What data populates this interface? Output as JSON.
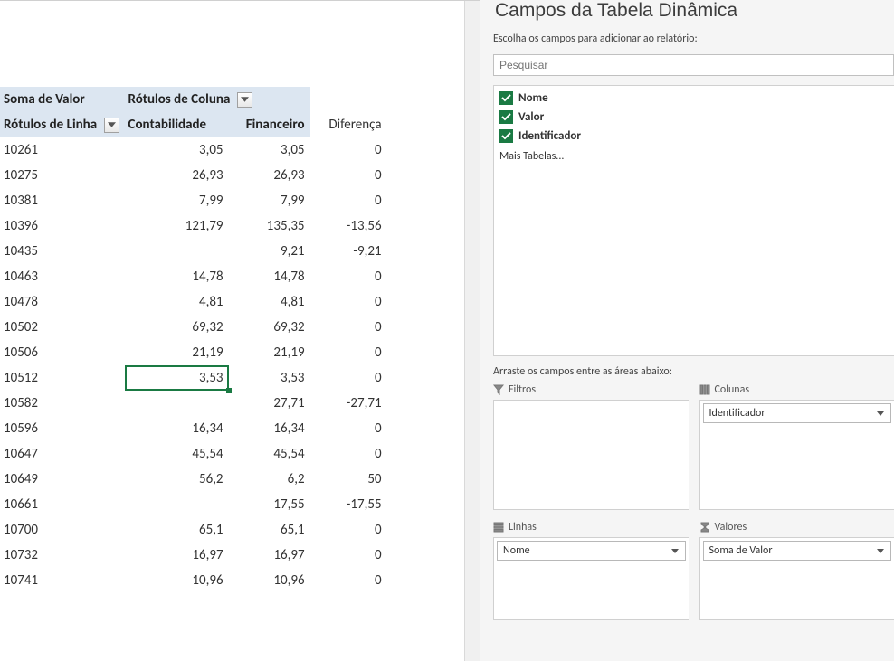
{
  "pivot": {
    "value_label": "Soma de Valor",
    "column_label_header": "Rótulos de Coluna",
    "row_label_header": "Rótulos de Linha",
    "col_headers": [
      "Contabilidade",
      "Financeiro",
      "Diferença"
    ],
    "rows": [
      {
        "id": "10261",
        "c": "3,05",
        "f": "3,05",
        "d": "0"
      },
      {
        "id": "10275",
        "c": "26,93",
        "f": "26,93",
        "d": "0"
      },
      {
        "id": "10381",
        "c": "7,99",
        "f": "7,99",
        "d": "0"
      },
      {
        "id": "10396",
        "c": "121,79",
        "f": "135,35",
        "d": "-13,56"
      },
      {
        "id": "10435",
        "c": "",
        "f": "9,21",
        "d": "-9,21"
      },
      {
        "id": "10463",
        "c": "14,78",
        "f": "14,78",
        "d": "0"
      },
      {
        "id": "10478",
        "c": "4,81",
        "f": "4,81",
        "d": "0"
      },
      {
        "id": "10502",
        "c": "69,32",
        "f": "69,32",
        "d": "0"
      },
      {
        "id": "10506",
        "c": "21,19",
        "f": "21,19",
        "d": "0"
      },
      {
        "id": "10512",
        "c": "3,53",
        "f": "3,53",
        "d": "0"
      },
      {
        "id": "10582",
        "c": "",
        "f": "27,71",
        "d": "-27,71"
      },
      {
        "id": "10596",
        "c": "16,34",
        "f": "16,34",
        "d": "0"
      },
      {
        "id": "10647",
        "c": "45,54",
        "f": "45,54",
        "d": "0"
      },
      {
        "id": "10649",
        "c": "56,2",
        "f": "6,2",
        "d": "50"
      },
      {
        "id": "10661",
        "c": "",
        "f": "17,55",
        "d": "-17,55"
      },
      {
        "id": "10700",
        "c": "65,1",
        "f": "65,1",
        "d": "0"
      },
      {
        "id": "10732",
        "c": "16,97",
        "f": "16,97",
        "d": "0"
      },
      {
        "id": "10741",
        "c": "10,96",
        "f": "10,96",
        "d": "0"
      }
    ],
    "selected_row_index": 9,
    "selected_col": "c",
    "tight_rows_from_index": 16
  },
  "field_pane": {
    "title": "Campos da Tabela Dinâmica",
    "instructions": "Escolha os campos para adicionar ao relatório:",
    "search_placeholder": "Pesquisar",
    "fields": [
      {
        "name": "Nome",
        "checked": true
      },
      {
        "name": "Valor",
        "checked": true
      },
      {
        "name": "Identificador",
        "checked": true
      }
    ],
    "more_tables": "Mais Tabelas...",
    "drag_instructions": "Arraste os campos entre as áreas abaixo:",
    "areas": {
      "filters": {
        "label": "Filtros",
        "items": []
      },
      "columns": {
        "label": "Colunas",
        "items": [
          "Identificador"
        ]
      },
      "rows": {
        "label": "Linhas",
        "items": [
          "Nome"
        ]
      },
      "values": {
        "label": "Valores",
        "items": [
          "Soma de Valor"
        ]
      }
    }
  }
}
